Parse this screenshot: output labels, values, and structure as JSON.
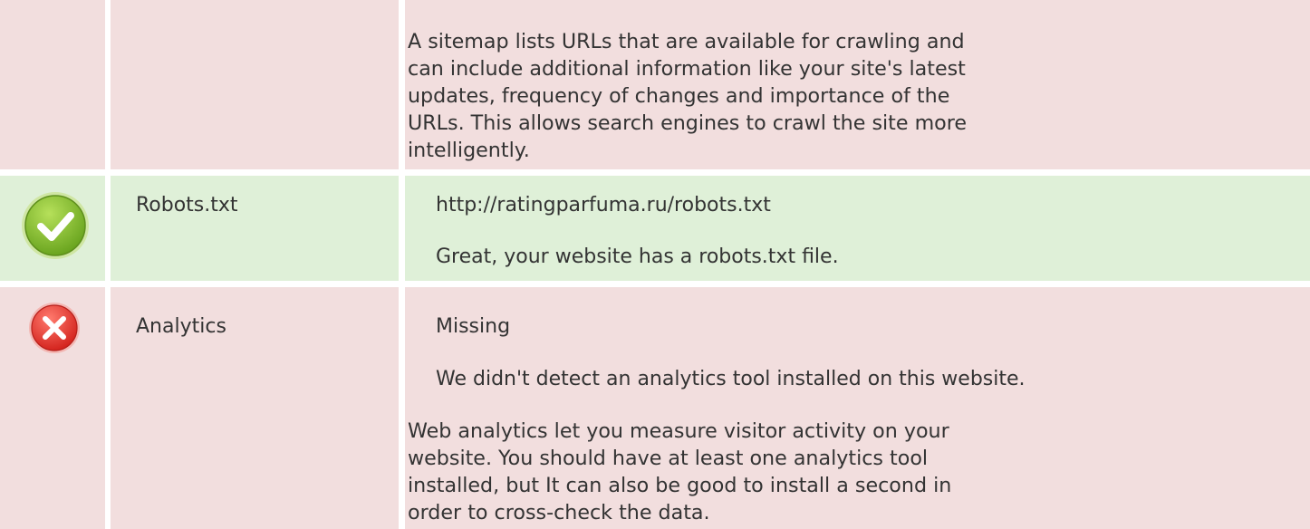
{
  "sitemap": {
    "description": "A sitemap lists URLs that are available for crawling and can include additional information like your site's latest updates, frequency of changes and importance of the URLs. This allows search engines to crawl the site more intelligently."
  },
  "robots": {
    "status_icon": "check-icon",
    "status_color": "#7cbb2a",
    "label": "Robots.txt",
    "url": "http://ratingparfuma.ru/robots.txt",
    "message": "Great, your website has a robots.txt file."
  },
  "analytics": {
    "status_icon": "error-icon",
    "status_color": "#e8423c",
    "label": "Analytics",
    "value": "Missing",
    "message": "We didn't detect an analytics tool installed on this website.",
    "description": "Web analytics let you measure visitor activity on your website. You should have at least one analytics tool installed, but It can also be good to install a second in order to cross-check the data."
  }
}
